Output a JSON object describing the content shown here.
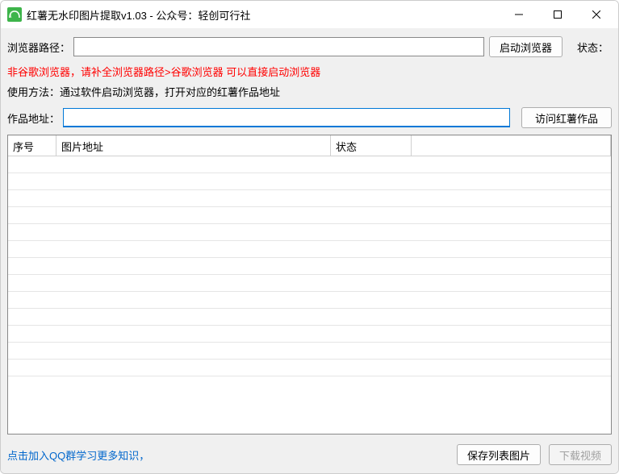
{
  "window": {
    "title": "红薯无水印图片提取v1.03 - 公众号：轻创可行社"
  },
  "toolbar": {
    "browser_path_label": "浏览器路径：",
    "browser_path_value": "",
    "start_browser_label": "启动浏览器",
    "status_label": "状态："
  },
  "notes": {
    "red_line": "非谷歌浏览器，请补全浏览器路径>谷歌浏览器 可以直接启动浏览器",
    "black_line": "使用方法：通过软件启动浏览器，打开对应的红薯作品地址"
  },
  "work": {
    "addr_label": "作品地址：",
    "addr_value": "",
    "visit_label": "访问红薯作品"
  },
  "table": {
    "columns": {
      "seq": "序号",
      "url": "图片地址",
      "status": "状态"
    },
    "rows": []
  },
  "footer": {
    "help_link": "点击加入QQ群学习更多知识，",
    "save_list_label": "保存列表图片",
    "download_video_label": "下载视频"
  }
}
